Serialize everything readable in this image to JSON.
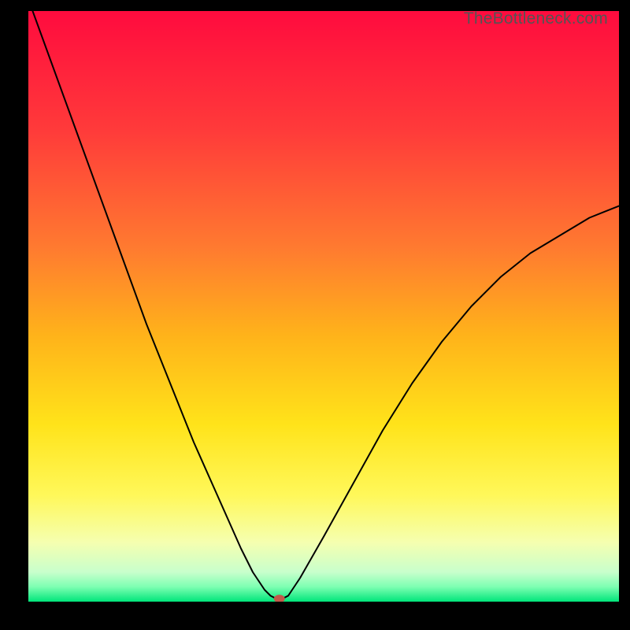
{
  "watermark": "TheBottleneck.com",
  "chart_data": {
    "type": "line",
    "title": "",
    "xlabel": "",
    "ylabel": "",
    "xlim": [
      0,
      100
    ],
    "ylim": [
      0,
      100
    ],
    "grid": false,
    "legend": false,
    "background": {
      "type": "vertical-gradient",
      "stops": [
        {
          "pos": 0.0,
          "color": "#ff0b3e"
        },
        {
          "pos": 0.2,
          "color": "#ff3a3a"
        },
        {
          "pos": 0.4,
          "color": "#ff7a30"
        },
        {
          "pos": 0.55,
          "color": "#ffb31a"
        },
        {
          "pos": 0.7,
          "color": "#ffe31a"
        },
        {
          "pos": 0.82,
          "color": "#fff85a"
        },
        {
          "pos": 0.9,
          "color": "#f5ffb0"
        },
        {
          "pos": 0.95,
          "color": "#c8ffcc"
        },
        {
          "pos": 0.975,
          "color": "#7dffb2"
        },
        {
          "pos": 1.0,
          "color": "#00e57a"
        }
      ]
    },
    "series": [
      {
        "name": "bottleneck-curve",
        "color": "#000000",
        "width": 2,
        "x": [
          0,
          4,
          8,
          12,
          16,
          20,
          24,
          28,
          32,
          36,
          38,
          40,
          41,
          42,
          43,
          44,
          46,
          50,
          55,
          60,
          65,
          70,
          75,
          80,
          85,
          90,
          95,
          100
        ],
        "values": [
          102,
          91,
          80,
          69,
          58,
          47,
          37,
          27,
          18,
          9,
          5,
          2,
          1,
          0.5,
          0.5,
          1,
          4,
          11,
          20,
          29,
          37,
          44,
          50,
          55,
          59,
          62,
          65,
          67
        ]
      }
    ],
    "markers": [
      {
        "name": "optimal-point",
        "x": 42.5,
        "y": 0.5,
        "color": "#c25a4a",
        "rx": 7,
        "ry": 5
      }
    ]
  }
}
